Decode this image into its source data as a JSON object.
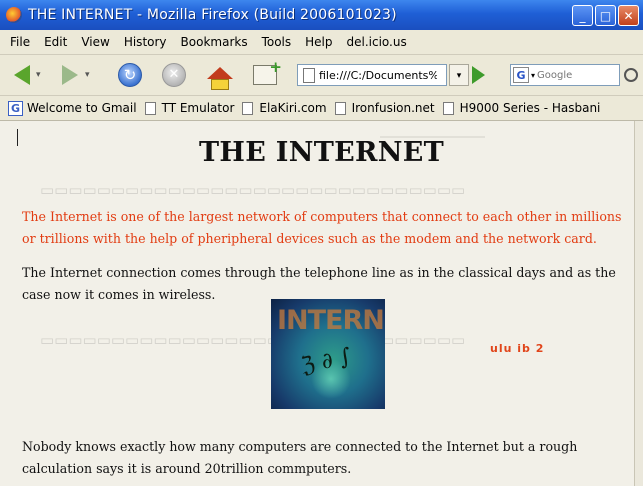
{
  "window": {
    "title": "THE INTERNET - Mozilla Firefox (Build 2006101023)",
    "minimize_glyph": "_",
    "maximize_glyph": "□",
    "close_glyph": "✕"
  },
  "menubar": {
    "items": [
      "File",
      "Edit",
      "View",
      "History",
      "Bookmarks",
      "Tools",
      "Help",
      "del.icio.us"
    ]
  },
  "toolbar": {
    "url": "file:///C:/Documents%",
    "search_placeholder": "Google",
    "search_engine_glyph": "G",
    "dropdown_glyph": "▾",
    "reload_glyph": "↻",
    "stop_glyph": "✕",
    "icons": [
      "back-icon",
      "forward-icon",
      "reload-icon",
      "stop-icon",
      "home-icon",
      "new-tab-icon",
      "go-icon",
      "search-icon"
    ]
  },
  "bookmarks": {
    "items": [
      {
        "label": "Welcome to Gmail",
        "icon": "gmail-icon",
        "glyph": "G"
      },
      {
        "label": "TT Emulator",
        "icon": "page-icon"
      },
      {
        "label": "ElaKiri.com",
        "icon": "page-icon"
      },
      {
        "label": "Ironfusion.net",
        "icon": "page-icon"
      },
      {
        "label": "H9000 Series - Hasbani",
        "icon": "page-icon"
      }
    ]
  },
  "page": {
    "heading": "THE INTERNET",
    "intro": "The Internet is one of the largest network of computers that connect to each other in millions or trillions with the help of pheripheral devices such as the modem and the network card.",
    "connection": "The Internet connection comes through the telephone line as in the classical days and as the case now it comes in wireless.",
    "image_text": "INTERNET",
    "image_scribble": "ℨ ∂ ∫",
    "figure_label": "ulu ib 2",
    "closing": "Nobody knows exactly how many computers are connected to the Internet but a rough calculation says it is around 20trillion commputers."
  },
  "colors": {
    "title_bar": "#1f5fd6",
    "chrome": "#ece9d8",
    "page_background": "#f2f0e8",
    "intro_text": "#e23c12",
    "figure_label": "#e1451a"
  }
}
